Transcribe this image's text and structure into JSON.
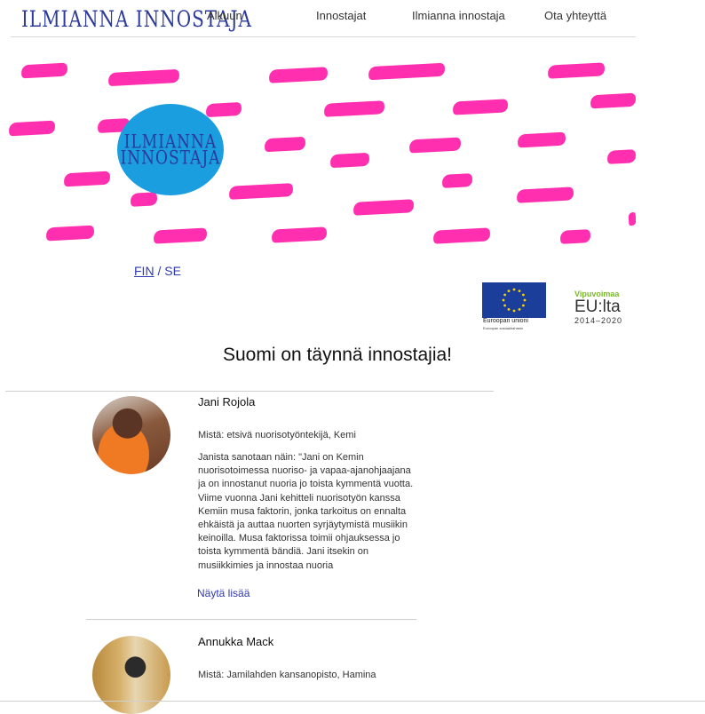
{
  "header": {
    "logo": "ILMIANNA INNOSTAJA",
    "nav": [
      "Alkuun",
      "Innostajat",
      "Ilmianna innostaja",
      "Ota yhteyttä"
    ]
  },
  "banner": {
    "logo_line1": "ILMIANNA",
    "logo_line2": "INNOSTAJA",
    "stroke_color": "#ff2fb0",
    "circle_color": "#1a9ee0"
  },
  "lang": {
    "fin": "FIN",
    "sep": "/",
    "se": "SE"
  },
  "funders": {
    "eu_label": "Euroopan unioni",
    "eu_sub": "Euroopan sosiaalirahasto",
    "vipu_top": "Vipuvoimaa",
    "vipu_mid": "EU:lta",
    "vipu_bot": "2014–2020"
  },
  "main": {
    "heading": "Suomi on täynnä innostajia!",
    "cards": [
      {
        "name": "Jani Rojola",
        "from": "Mistä: etsivä nuorisotyöntekijä, Kemi",
        "description": "Janista sanotaan näin: \"Jani on Kemin nuorisotoimessa nuoriso- ja vapaa-ajanohjaajana ja on innostanut nuoria jo toista kymmentä vuotta. Viime vuonna Jani kehitteli nuorisotyön kanssa Kemiin musa faktorin, jonka tarkoitus on ennalta ehkäistä ja auttaa nuorten syrjäytymistä musiikin keinoilla. Musa faktorissa toimii ohjauksessa jo toista kymmentä bändiä. Jani itsekin on musiikkimies ja innostaa nuoria",
        "more": "Näytä lisää"
      },
      {
        "name": "Annukka Mack",
        "from": "Mistä: Jamilahden kansanopisto, Hamina"
      }
    ]
  }
}
